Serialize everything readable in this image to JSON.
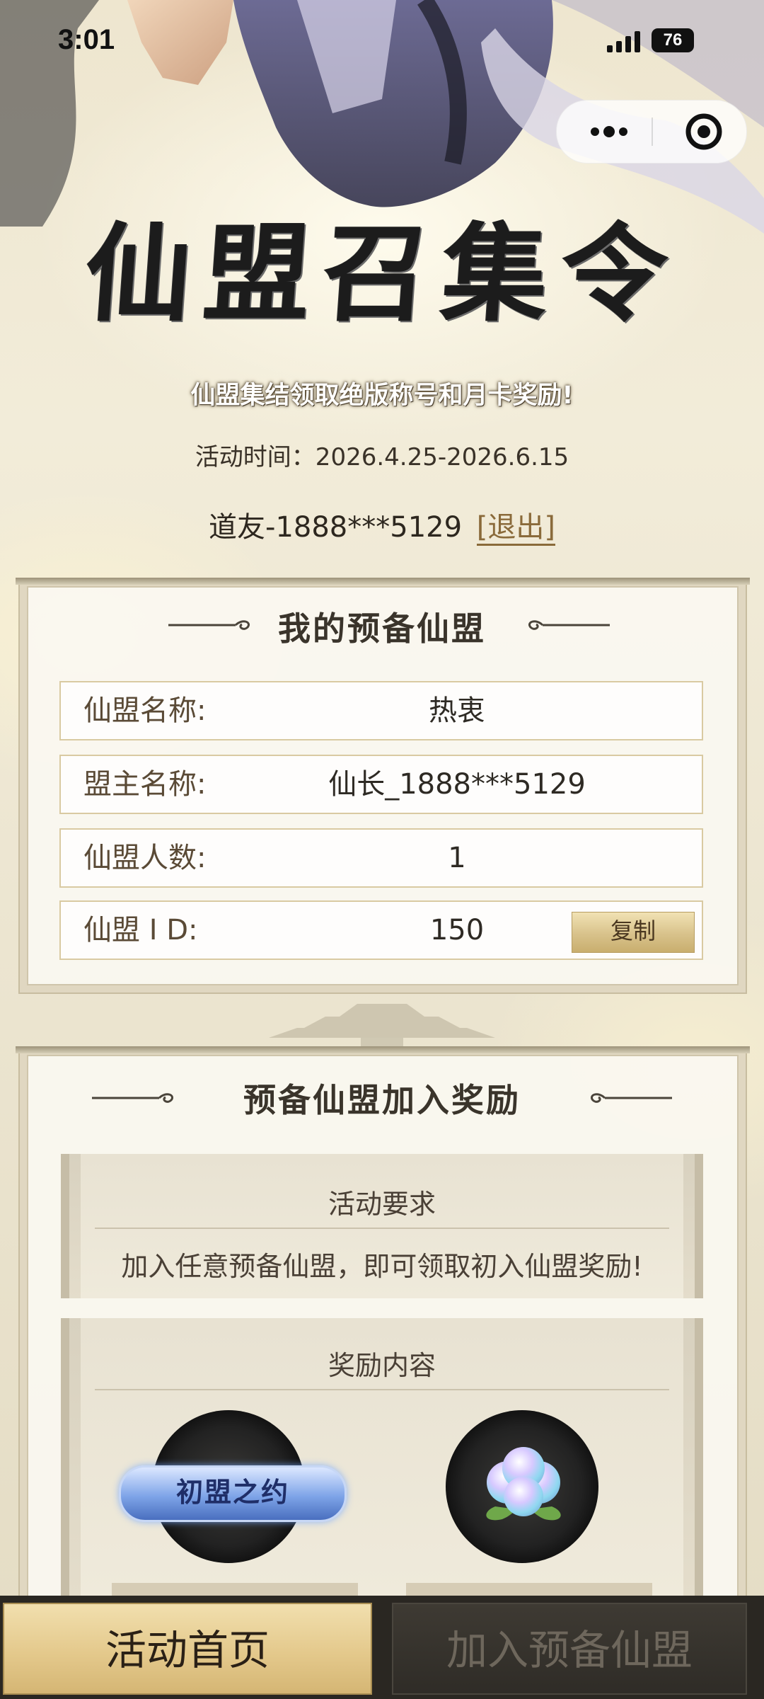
{
  "status_bar": {
    "time": "3:01",
    "battery": "76"
  },
  "header": {
    "title": "仙盟召集令",
    "subtitle": "仙盟集结领取绝版称号和月卡奖励!",
    "activity_time": "活动时间：2026.4.25-2026.6.15",
    "user_name": "道友-1888***5129",
    "logout_label": "[退出]"
  },
  "my_guild": {
    "title": "我的预备仙盟",
    "rows": [
      {
        "label": "仙盟名称:",
        "value": "热衷"
      },
      {
        "label": "盟主名称:",
        "value": "仙长_1888***5129"
      },
      {
        "label": "仙盟人数:",
        "value": "1"
      },
      {
        "label": "仙盟 I D:",
        "value": "150"
      }
    ],
    "copy_label": "复制"
  },
  "join_reward": {
    "title": "预备仙盟加入奖励",
    "requirement_heading": "活动要求",
    "requirement_text": "加入任意预备仙盟，即可领取初入仙盟奖励!",
    "reward_heading": "奖励内容",
    "rewards": [
      {
        "name": "初盟之约",
        "icon": "title-badge-icon"
      },
      {
        "name": "",
        "icon": "spirit-peach-icon"
      }
    ]
  },
  "bottom_nav": {
    "home_label": "活动首页",
    "join_label": "加入预备仙盟"
  },
  "colors": {
    "gold": "#d8bd7c",
    "dark_nav": "#2a2722",
    "panel_border": "#cfc5ab"
  }
}
